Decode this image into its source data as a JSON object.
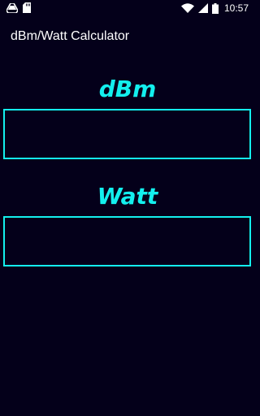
{
  "status_bar": {
    "time": "10:57",
    "icons": [
      "drive-icon",
      "sd-card-icon",
      "wifi-icon",
      "signal-icon",
      "battery-icon"
    ]
  },
  "app": {
    "title": "dBm/Watt Calculator"
  },
  "dbm": {
    "label": "dBm",
    "value": "",
    "placeholder": ""
  },
  "watt": {
    "label": "Watt",
    "value": "",
    "placeholder": ""
  },
  "colors": {
    "background": "#04001a",
    "accent": "#13f0ee",
    "text": "#ffffff"
  }
}
